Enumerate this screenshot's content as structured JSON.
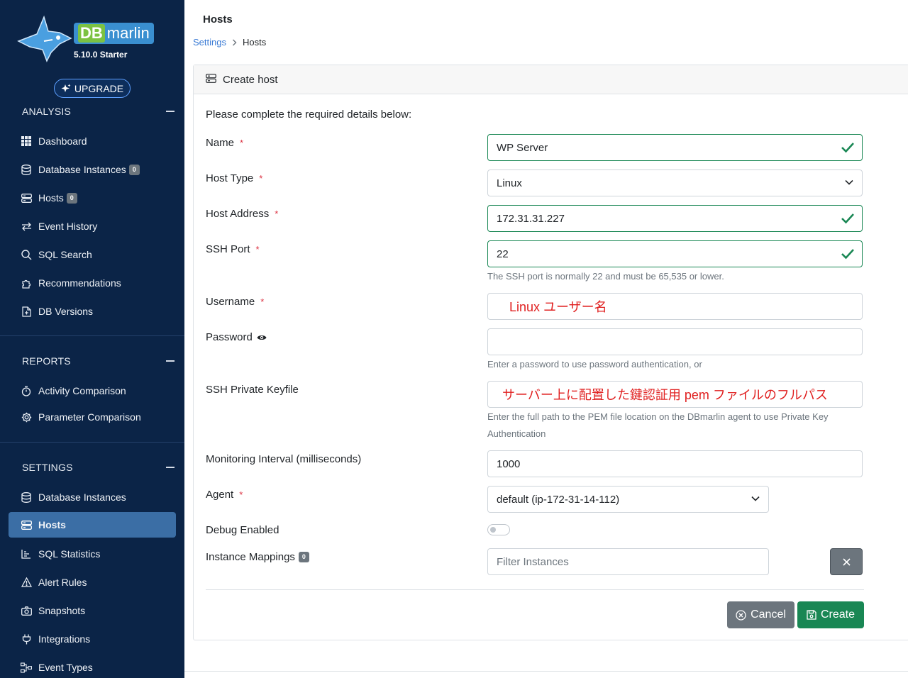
{
  "brand": {
    "db": "DB",
    "marlin": "marlin",
    "version": "5.10.0 Starter",
    "upgrade_label": "UPGRADE"
  },
  "sidebar": {
    "analysis": {
      "title": "ANALYSIS",
      "items": [
        {
          "label": "Dashboard",
          "icon": "grid-icon"
        },
        {
          "label": "Database Instances",
          "icon": "database-icon",
          "badge": "0"
        },
        {
          "label": "Hosts",
          "icon": "server-icon",
          "badge": "0"
        },
        {
          "label": "Event History",
          "icon": "arrows-icon"
        },
        {
          "label": "SQL Search",
          "icon": "search-icon"
        },
        {
          "label": "Recommendations",
          "icon": "puzzle-icon"
        },
        {
          "label": "DB Versions",
          "icon": "file-icon"
        }
      ]
    },
    "reports": {
      "title": "REPORTS",
      "items": [
        {
          "label": "Activity Comparison",
          "icon": "stopwatch-icon"
        },
        {
          "label": "Parameter Comparison",
          "icon": "gear-icon"
        }
      ]
    },
    "settings": {
      "title": "SETTINGS",
      "items": [
        {
          "label": "Database Instances",
          "icon": "database-icon"
        },
        {
          "label": "Hosts",
          "icon": "server-icon",
          "active": true
        },
        {
          "label": "SQL Statistics",
          "icon": "bar-chart-icon"
        },
        {
          "label": "Alert Rules",
          "icon": "warning-icon"
        },
        {
          "label": "Snapshots",
          "icon": "camera-icon"
        },
        {
          "label": "Integrations",
          "icon": "plug-icon"
        },
        {
          "label": "Event Types",
          "icon": "diagram-icon"
        }
      ]
    }
  },
  "header": {
    "title": "Hosts",
    "breadcrumb": [
      "Settings",
      "Hosts"
    ]
  },
  "form": {
    "card_title": "Create host",
    "intro": "Please complete the required details below:",
    "name": {
      "label": "Name",
      "value": "WP Server"
    },
    "host_type": {
      "label": "Host Type",
      "value": "Linux"
    },
    "host_address": {
      "label": "Host Address",
      "value": "172.31.31.227"
    },
    "ssh_port": {
      "label": "SSH Port",
      "value": "22",
      "help": "The SSH port is normally 22 and must be 65,535 or lower."
    },
    "username": {
      "label": "Username",
      "value": "Linux ユーザー名"
    },
    "password": {
      "label": "Password",
      "value": "",
      "help": "Enter a password to use password authentication, or"
    },
    "keyfile": {
      "label": "SSH Private Keyfile",
      "value": "サーバー上に配置した鍵認証用 pem ファイルのフルパス",
      "help": "Enter the full path to the PEM file location on the DBmarlin agent to use Private Key Authentication"
    },
    "interval": {
      "label": "Monitoring Interval (milliseconds)",
      "value": "1000"
    },
    "agent": {
      "label": "Agent",
      "value": "default (ip-172-31-14-112)"
    },
    "debug": {
      "label": "Debug Enabled",
      "enabled": false
    },
    "mappings": {
      "label": "Instance Mappings",
      "badge": "0",
      "placeholder": "Filter Instances"
    },
    "required_mark": "*",
    "cancel_label": "Cancel",
    "create_label": "Create"
  },
  "colors": {
    "sidebar_bg": "#0b2447",
    "active_item": "#3b6ea5",
    "success": "#198754",
    "danger": "#dc3545",
    "secondary": "#6c757d",
    "link": "#3a7bd5"
  }
}
